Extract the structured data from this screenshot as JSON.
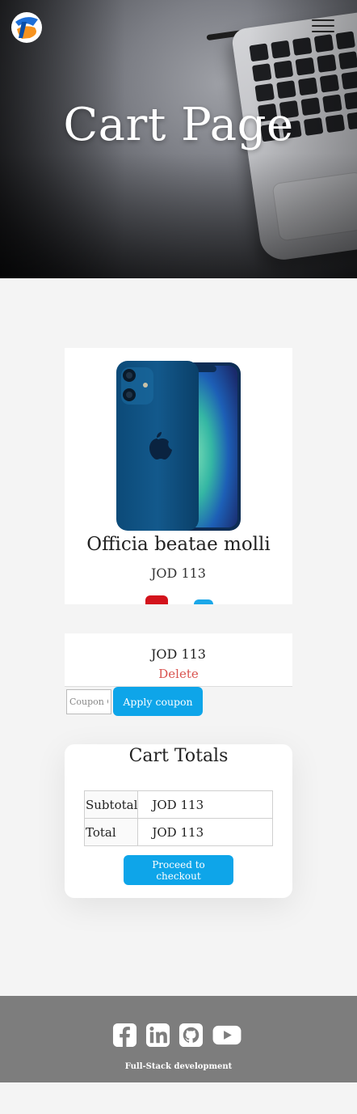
{
  "hero": {
    "title": "Cart Page",
    "logo_icon": "brand-logo-icon",
    "menu_icon": "hamburger-menu-icon"
  },
  "product": {
    "name": "Officia beatae molli",
    "price": "JOD 113",
    "image_icon": "smartphone-image",
    "colors": [
      "#d3131c",
      "#1ba7e8"
    ]
  },
  "line_item": {
    "price": "JOD 113",
    "delete_label": "Delete"
  },
  "coupon": {
    "placeholder": "Coupon Code",
    "apply_label": "Apply coupon"
  },
  "totals": {
    "title": "Cart Totals",
    "rows": [
      {
        "label": "Subtotal",
        "value": "JOD 113"
      },
      {
        "label": "Total",
        "value": "JOD 113"
      }
    ],
    "checkout_label": "Proceed to checkout"
  },
  "footer": {
    "icons": [
      "facebook-icon",
      "linkedin-icon",
      "github-icon",
      "youtube-icon"
    ],
    "text": "Full-Stack development"
  },
  "colors": {
    "accent": "#0ea5e9",
    "danger": "#d9534f",
    "footer_bg": "#7d7d7d",
    "page_bg": "#f4f4f4"
  }
}
